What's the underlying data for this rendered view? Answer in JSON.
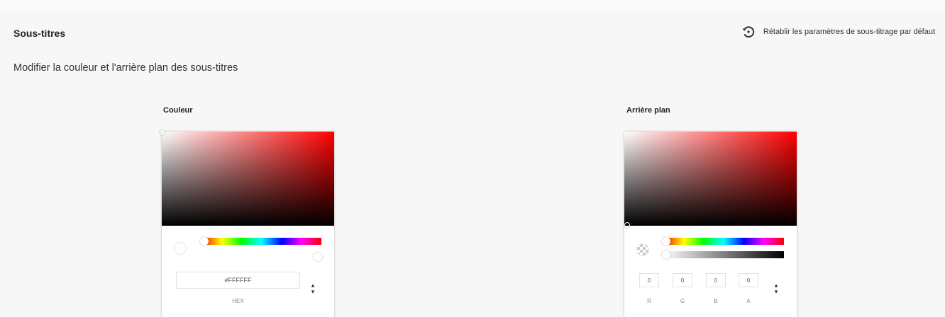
{
  "section": {
    "title": "Sous-titres",
    "reset_label": "Rétablir les paramètres de sous-titrage par défaut",
    "reset_icon": "reset-icon"
  },
  "subtitle": "Modifier la couleur et l'arrière plan des sous-titres",
  "color_picker": {
    "title": "Couleur",
    "hue_color": "#ff0000",
    "hex_value": "#FFFFFF",
    "hex_label": "HEX"
  },
  "background_picker": {
    "title": "Arrière plan",
    "hue_color": "#ff0000",
    "rgba_values": [
      "0",
      "0",
      "0",
      "0"
    ],
    "rgba_labels": [
      "R",
      "G",
      "B",
      "A"
    ]
  }
}
